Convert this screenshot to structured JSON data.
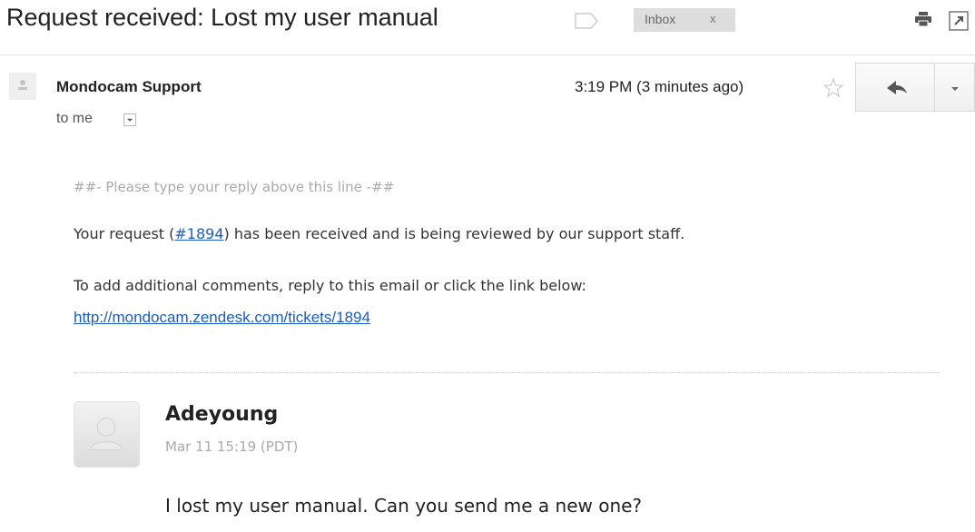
{
  "header": {
    "subject": "Request received: Lost my user manual",
    "label_chip": "Inbox",
    "label_chip_close": "x"
  },
  "message": {
    "sender": "Mondocam Support",
    "recipient": "to me",
    "time": "3:19 PM (3 minutes ago)"
  },
  "body": {
    "reply_marker": "##- Please type your reply above this line -##",
    "request_prefix": "Your request (",
    "request_id": "#1894",
    "request_suffix": ") has been received and is being reviewed by our support staff.",
    "add_comments": "To add additional comments, reply to this email or click the link below:",
    "ticket_url": "http://mondocam.zendesk.com/tickets/1894"
  },
  "comment": {
    "author": "Adeyoung",
    "date": "Mar 11 15:19 (PDT)",
    "text": "I lost my user manual. Can you send me a new one?"
  },
  "icons": {
    "label": "label-icon",
    "print": "print-icon",
    "popout": "new-window-icon",
    "star": "star-icon",
    "reply": "reply-arrow-icon",
    "more": "chevron-down-icon",
    "avatar": "person-icon"
  }
}
